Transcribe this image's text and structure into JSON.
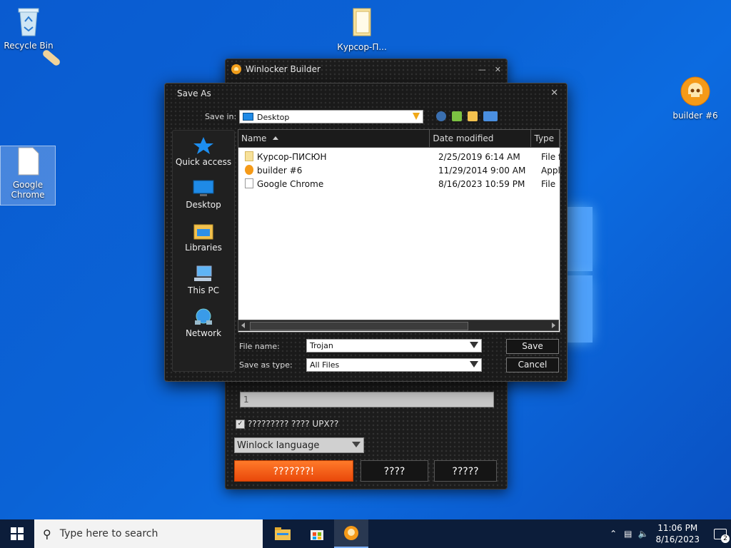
{
  "desktop": {
    "icons": {
      "recycle_bin": "Recycle Bin",
      "folder": "Курсор-П...",
      "builder": "builder #6",
      "chrome": "Google Chrome"
    }
  },
  "builder": {
    "title": "Winlocker Builder",
    "number_value": "1",
    "upx_label": "????????? ???? UPX??",
    "upx_checked": true,
    "language_select": "Winlock language",
    "btn_build": "???????!",
    "btn_2": "????",
    "btn_3": "?????"
  },
  "saveas": {
    "title": "Save As",
    "save_in_label": "Save in:",
    "save_in_value": "Desktop",
    "sidebar": {
      "quick_access": "Quick access",
      "desktop": "Desktop",
      "libraries": "Libraries",
      "this_pc": "This PC",
      "network": "Network"
    },
    "columns": [
      "Name",
      "Date modified",
      "Type"
    ],
    "files": [
      {
        "name": "Курсор-ПИСЮН",
        "date": "2/25/2019 6:14 AM",
        "type": "File fo",
        "icon": "folder-icon"
      },
      {
        "name": "builder #6",
        "date": "11/29/2014 9:00 AM",
        "type": "Appli",
        "icon": "app-icon"
      },
      {
        "name": "Google Chrome",
        "date": "8/16/2023 10:59 PM",
        "type": "File",
        "icon": "file-icon"
      }
    ],
    "file_name_label": "File name:",
    "file_name_value": "Trojan",
    "save_type_label": "Save as type:",
    "save_type_value": "All Files",
    "save_btn": "Save",
    "cancel_btn": "Cancel"
  },
  "taskbar": {
    "search_placeholder": "Type here to search",
    "time": "11:06 PM",
    "date": "8/16/2023",
    "notif_count": "2"
  },
  "colors": {
    "desktop_bg": "#0b63d6",
    "accent_orange": "#f26a1b",
    "dialog_bg": "#1a1a1a"
  }
}
